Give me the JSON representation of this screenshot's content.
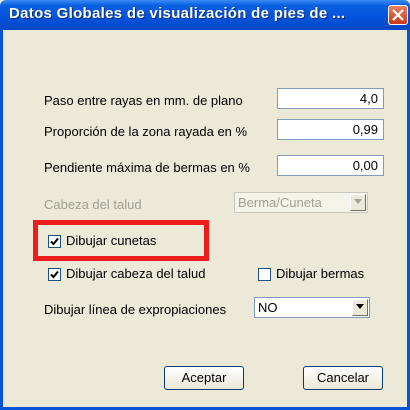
{
  "window": {
    "title": "Datos Globales de visualización de pies de ...",
    "close_icon": "close-x-icon"
  },
  "fields": {
    "paso_label": "Paso entre rayas en mm. de plano",
    "paso_value": "4,0",
    "proporcion_label": "Proporción de la zona rayada  en %",
    "proporcion_value": "0,99",
    "pendiente_label": "Pendiente máxima de bermas en %",
    "pendiente_value": "0,00",
    "cabeza_label": "Cabeza del talud",
    "cabeza_value": "Berma/Cuneta",
    "expropiaciones_label": "Dibujar línea de expropiaciones",
    "expropiaciones_value": "NO"
  },
  "checkboxes": {
    "cunetas_label": "Dibujar cunetas",
    "cunetas_checked": true,
    "cabeza_talud_label": "Dibujar cabeza del talud",
    "cabeza_talud_checked": true,
    "bermas_label": "Dibujar bermas",
    "bermas_checked": false
  },
  "buttons": {
    "accept_label": "Aceptar",
    "cancel_label": "Cancelar"
  },
  "colors": {
    "titlebar": "#0353dd",
    "highlight": "#ee1c1c",
    "dialog_bg": "#ece9d8"
  }
}
